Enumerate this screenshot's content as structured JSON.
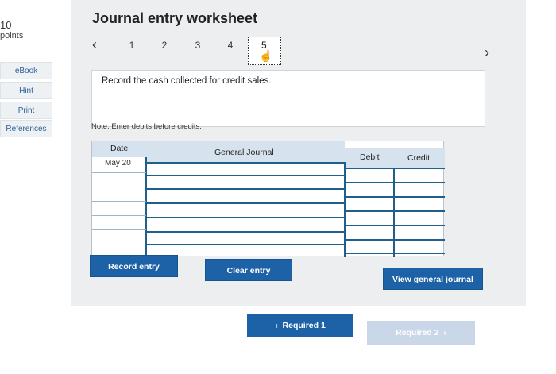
{
  "sidebar": {
    "points_value": "10",
    "points_label": "points",
    "links": [
      "eBook",
      "Hint",
      "Print",
      "References"
    ]
  },
  "worksheet": {
    "title": "Journal entry worksheet",
    "tabs": [
      "1",
      "2",
      "3",
      "4",
      "5"
    ],
    "active_tab": "5",
    "instruction": "Record the cash collected for credit sales.",
    "note": "Note: Enter debits before credits."
  },
  "table": {
    "headers": {
      "date": "Date",
      "general_journal": "General Journal",
      "debit": "Debit",
      "credit": "Credit"
    },
    "rows": [
      {
        "date": "May 20",
        "account": "",
        "debit": "",
        "credit": ""
      },
      {
        "date": "",
        "account": "",
        "debit": "",
        "credit": ""
      },
      {
        "date": "",
        "account": "",
        "debit": "",
        "credit": ""
      },
      {
        "date": "",
        "account": "",
        "debit": "",
        "credit": ""
      },
      {
        "date": "",
        "account": "",
        "debit": "",
        "credit": ""
      },
      {
        "date": "",
        "account": "",
        "debit": "",
        "credit": ""
      }
    ]
  },
  "buttons": {
    "record_entry": "Record entry",
    "clear_entry": "Clear entry",
    "view_general_journal": "View general journal"
  },
  "footer": {
    "prev_label": "Required 1",
    "next_label": "Required 2"
  },
  "colors": {
    "button_blue": "#1d62a7",
    "disabled_blue": "#c9d7e8",
    "grid_line": "#1f5f8b"
  }
}
